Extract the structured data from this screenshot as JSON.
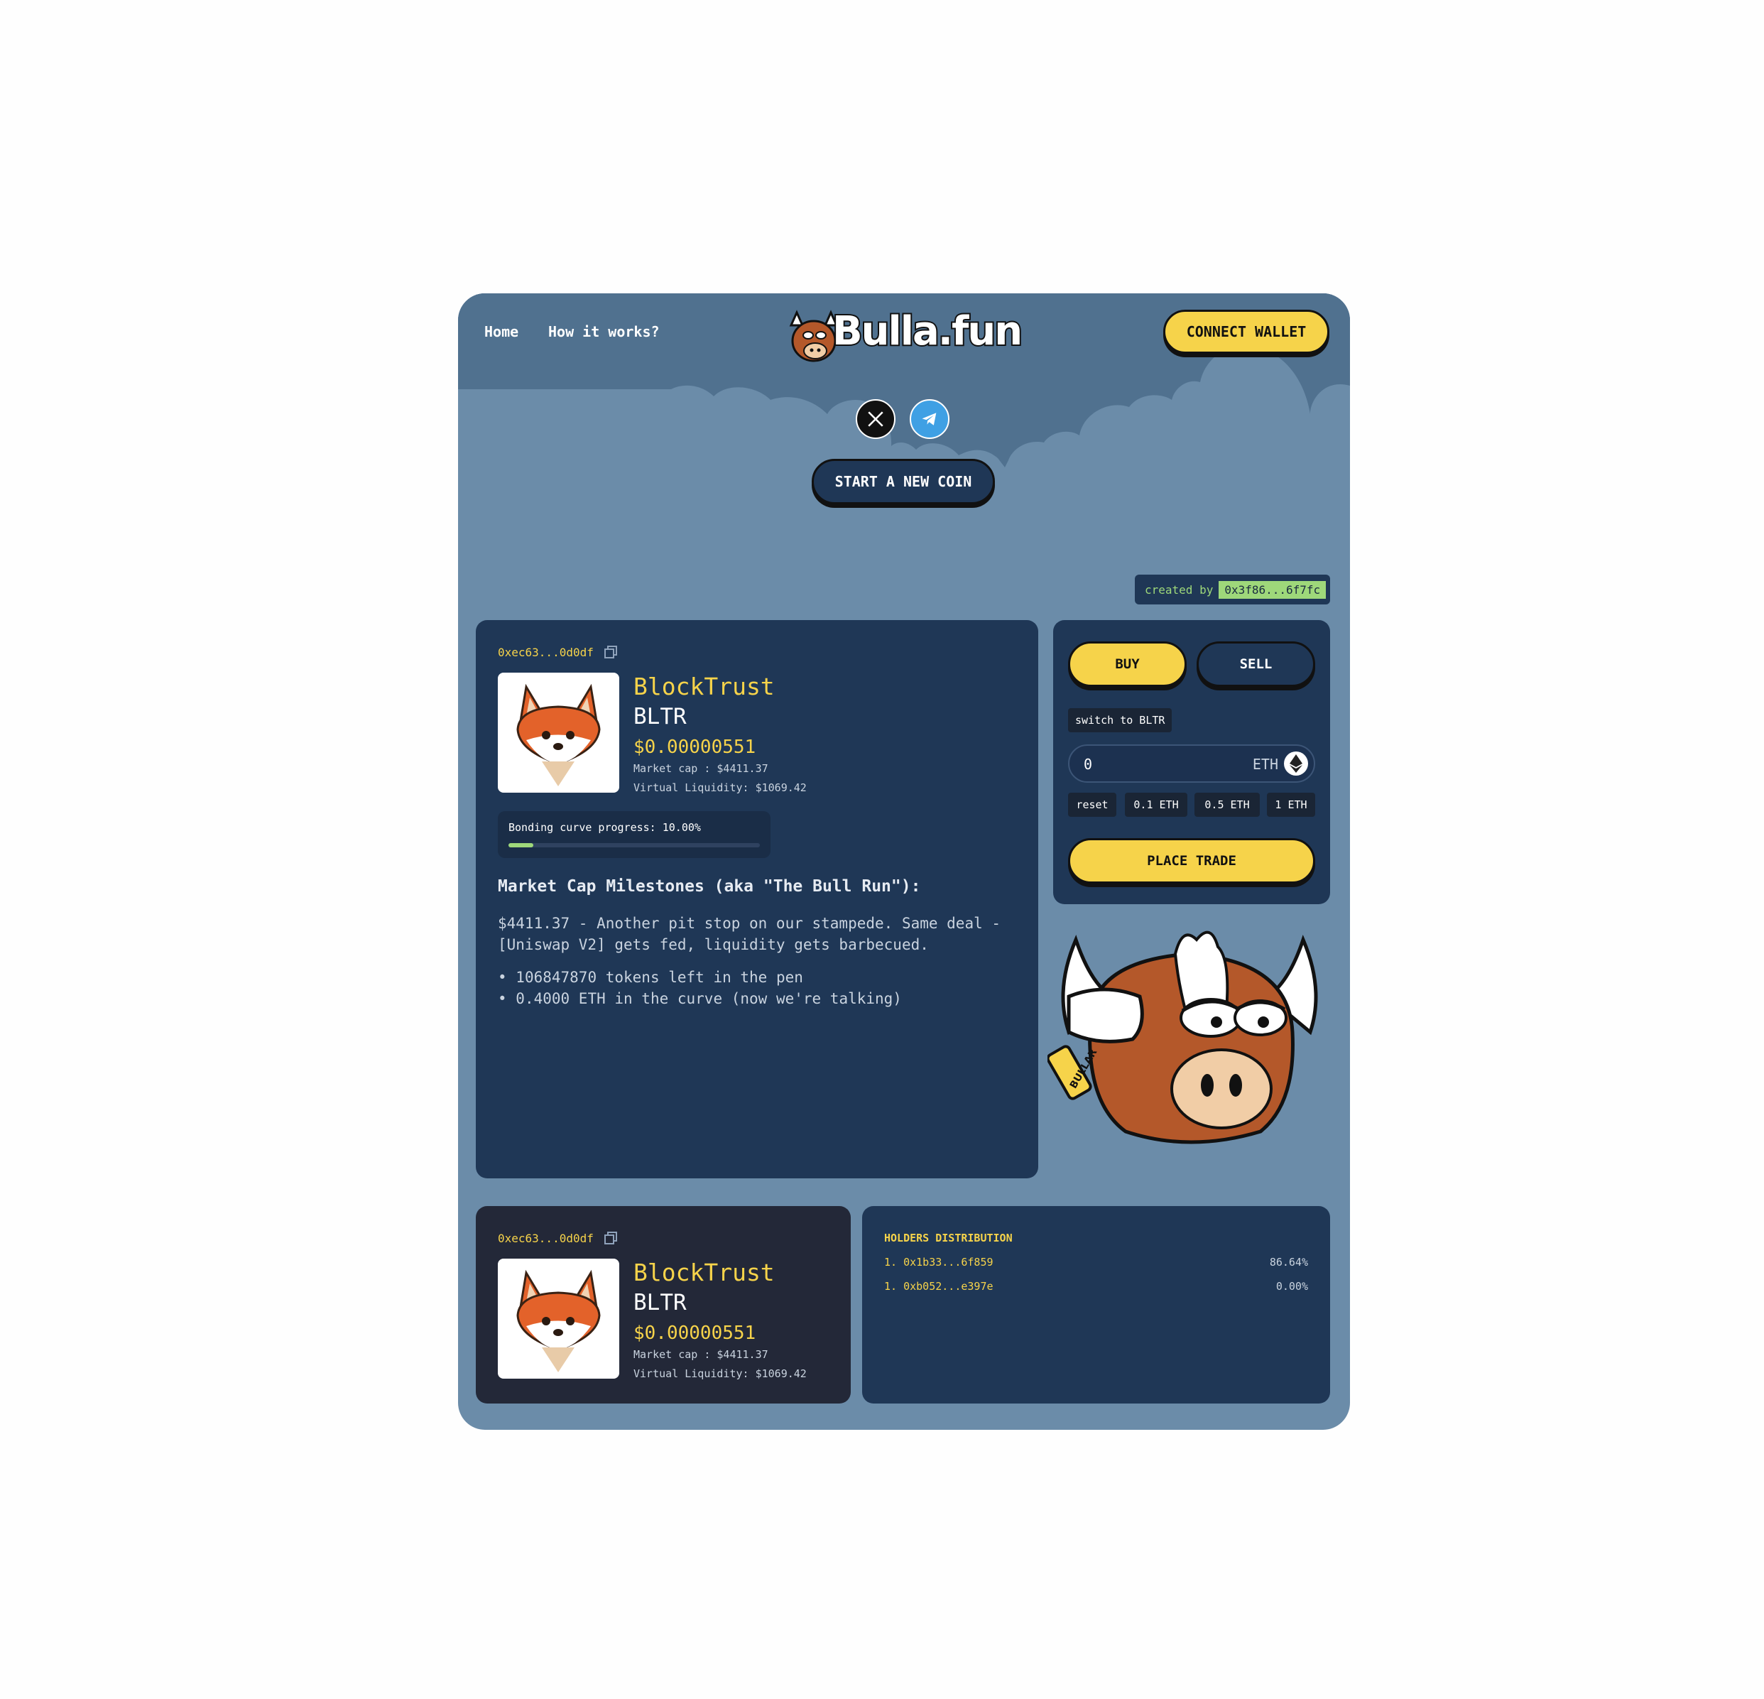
{
  "nav": {
    "home": "Home",
    "how": "How it works?"
  },
  "logo": {
    "text": "Bulla.fun"
  },
  "header": {
    "connect_wallet": "CONNECT WALLET"
  },
  "hero": {
    "start_coin": "START A NEW COIN"
  },
  "creator": {
    "label": "created by",
    "address": "0x3f86...6f7fc"
  },
  "token": {
    "address": "0xec63...0d0df",
    "name": "BlockTrust",
    "symbol": "BLTR",
    "price": "$0.00000551",
    "market_cap": "Market cap : $4411.37",
    "liquidity": "Virtual Liquidity: $1069.42",
    "bonding_label": "Bonding curve progress: 10.00%",
    "bonding_progress": 0.1
  },
  "milestones": {
    "title": "Market Cap Milestones (aka \"The Bull Run\"):",
    "description": "$4411.37 - Another pit stop on our stampede. Same deal - [Uniswap V2] gets fed, liquidity gets barbecued.",
    "items": [
      "106847870 tokens left in the pen",
      "0.4000 ETH in the curve (now we're talking)"
    ]
  },
  "trade": {
    "buy": "BUY",
    "sell": "SELL",
    "switch": "switch to BLTR",
    "amount": "0",
    "unit": "ETH",
    "quick": [
      "reset",
      "0.1 ETH",
      "0.5 ETH",
      "1 ETH"
    ],
    "place": "PLACE TRADE"
  },
  "mascot": {
    "tag": "BULLAR"
  },
  "holders": {
    "title": "HOLDERS DISTRIBUTION",
    "rows": [
      {
        "rank": "1.",
        "address": "0x1b33...6f859",
        "pct": "86.64%"
      },
      {
        "rank": "1.",
        "address": "0xb052...e397e",
        "pct": "0.00%"
      }
    ]
  },
  "colors": {
    "accent": "#f6d34a",
    "panel": "#1f3756",
    "bg": "#6b8ca9",
    "green": "#9ed87a"
  }
}
